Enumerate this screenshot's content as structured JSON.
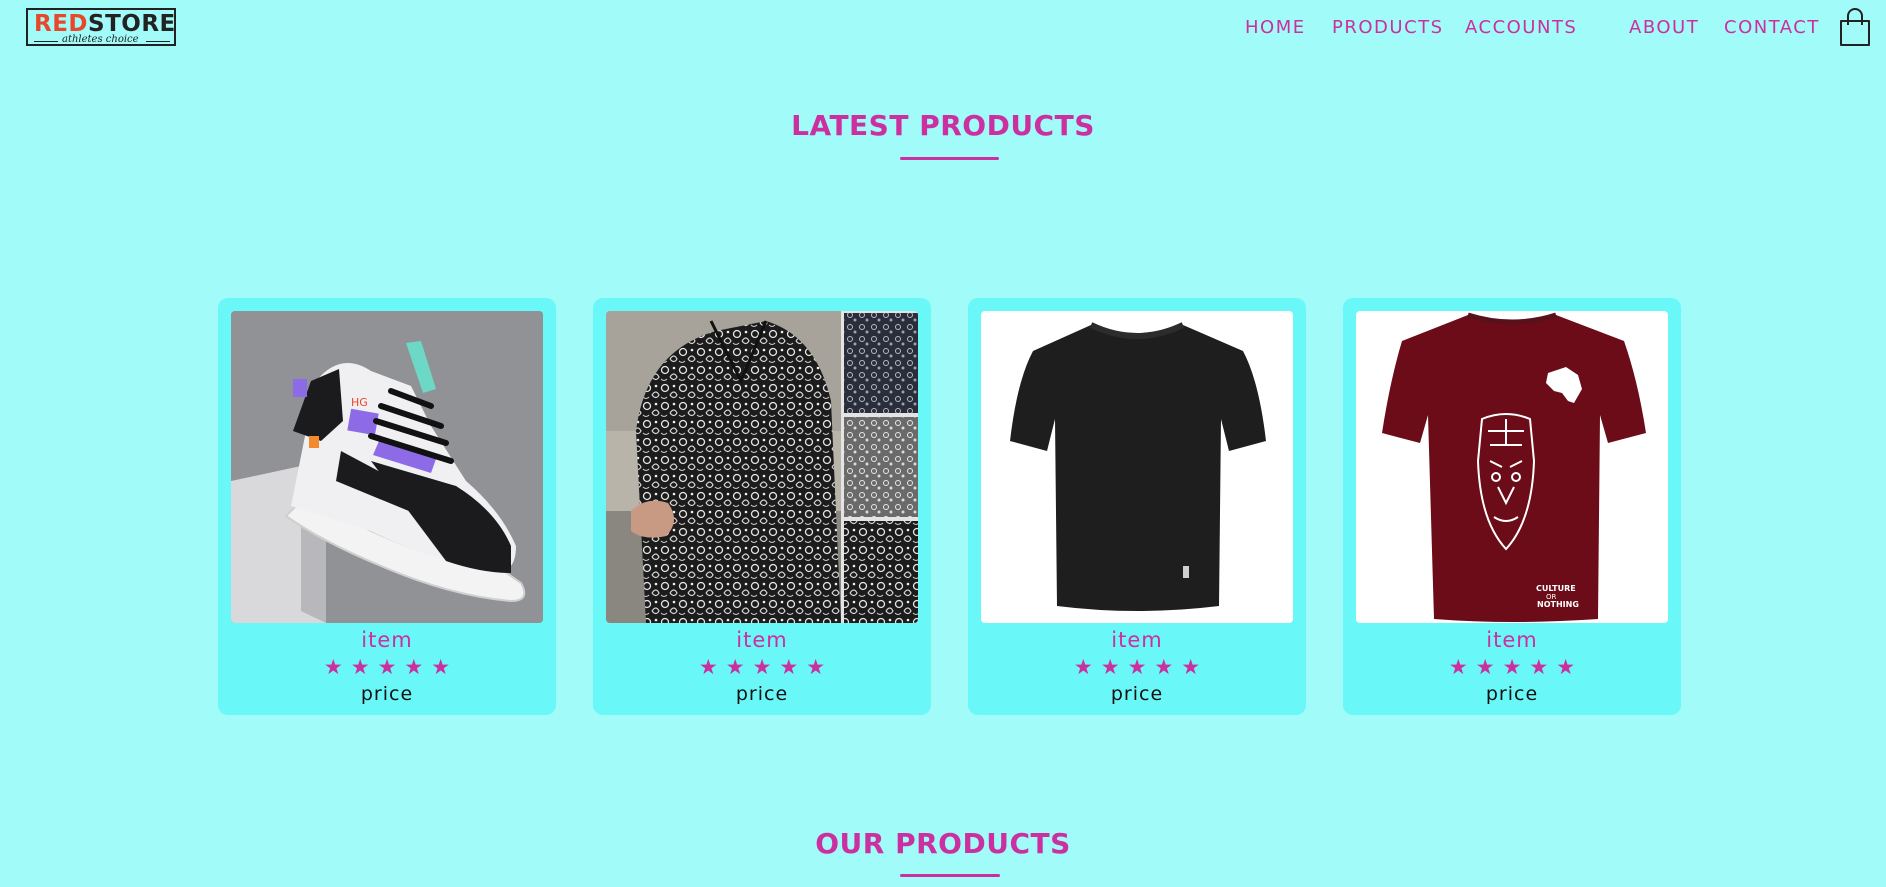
{
  "brand": {
    "logo_part1": "RED",
    "logo_part2": "STORE",
    "tagline": "athletes choice"
  },
  "nav": {
    "items": [
      "HOME",
      "PRODUCTS",
      "ACCOUNTS",
      "ABOUT",
      "CONTACT"
    ],
    "cart_icon": "shopping-bag-icon"
  },
  "latest": {
    "title": "LATEST PRODUCTS",
    "products": [
      {
        "name": "item",
        "rating": 5,
        "stars": "★★★★★",
        "price": "price",
        "image": "sneaker-image"
      },
      {
        "name": "item",
        "rating": 5,
        "stars": "★★★★★",
        "price": "price",
        "image": "patterned-shirt-image"
      },
      {
        "name": "item",
        "rating": 5,
        "stars": "★★★★★",
        "price": "price",
        "image": "black-tshirt-image"
      },
      {
        "name": "item",
        "rating": 5,
        "stars": "★★★★★",
        "price": "price",
        "image": "maroon-tshirt-image"
      }
    ],
    "image_caption": "CULTURE OR NOTHING"
  },
  "ours": {
    "title": "OUR PRODUCTS"
  },
  "colors": {
    "background": "#a1fbf8",
    "card": "#6af7f7",
    "accent": "#cc2fa0",
    "logo_red": "#e8472c"
  }
}
